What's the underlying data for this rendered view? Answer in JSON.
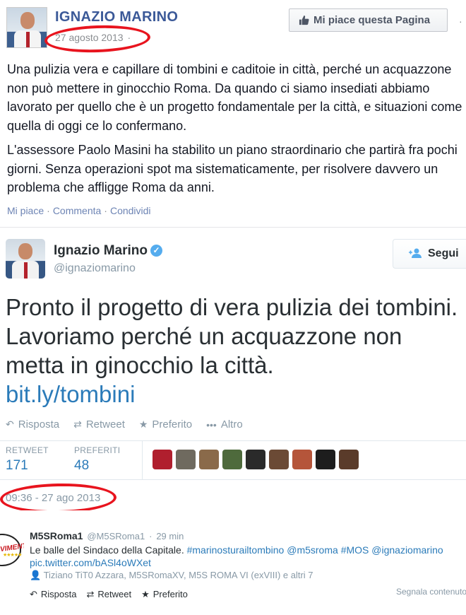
{
  "facebook_post": {
    "page_name": "IGNAZIO MARINO",
    "date": "27 agosto 2013",
    "date_separator": "·",
    "like_page_button": "Mi piace questa Pagina",
    "paragraphs": [
      "Una pulizia vera e capillare di tombini e caditoie in città, perché un acquazzone non può mettere in ginocchio Roma. Da quando ci siamo insediati abbiamo lavorato per quello che è un progetto fondamentale per la città, e situazioni come quella di oggi ce lo confermano.",
      "L'assessore Paolo Masini ha stabilito un piano straordinario che partirà fra pochi giorni. Senza operazioni spot ma sistematicamente, per risolvere davvero un problema che affligge Roma da anni."
    ],
    "actions": {
      "like": "Mi piace",
      "comment": "Commenta",
      "share": "Condividi",
      "separator": "·"
    }
  },
  "tweet": {
    "display_name": "Ignazio Marino",
    "verified_mark": "✓",
    "handle": "@ignaziomarino",
    "follow_button": "Segui",
    "text": "Pronto il progetto di vera pulizia dei tombini. Lavoriamo perché un acquazzone non metta in ginocchio la città.",
    "link": "bit.ly/tombini",
    "actions": {
      "reply": "Risposta",
      "retweet": "Retweet",
      "favorite": "Preferito",
      "more": "Altro"
    },
    "stats": {
      "retweet_label": "RETWEET",
      "retweet_count": "171",
      "favorites_label": "PREFERITI",
      "favorites_count": "48"
    },
    "timestamp": "09:36 - 27 ago 2013",
    "favoriter_avatar_colors": [
      "#b01f2e",
      "#6f6a5f",
      "#8a6a4a",
      "#4e6a3c",
      "#2a2a2a",
      "#6b4a35",
      "#b5553a",
      "#1d1d1d",
      "#5a3b2a"
    ]
  },
  "reply_tweet": {
    "avatar_text": "VIMENTO",
    "display_name": "M5SRoma1",
    "handle": "@M5SRoma1",
    "time_ago": "29 min",
    "text": "Le balle del Sindaco della Capitale.",
    "hashtags": [
      "#marinosturailtombino",
      "@m5sroma",
      "#MOS",
      "@ignaziomarino"
    ],
    "pic_link": "pic.twitter.com/bASl4oWXet",
    "retweeted_by": "Tiziano TiT0 Azzara, M5SRomaXV, M5S ROMA VI (exVIII) e altri 7",
    "actions": {
      "reply": "Risposta",
      "retweet": "Retweet",
      "favorite": "Preferito"
    },
    "report": "Segnala contenuto"
  },
  "colors": {
    "facebook_blue": "#3b5998",
    "twitter_blue": "#2b7bb9",
    "annotation_red": "#e8141e"
  }
}
